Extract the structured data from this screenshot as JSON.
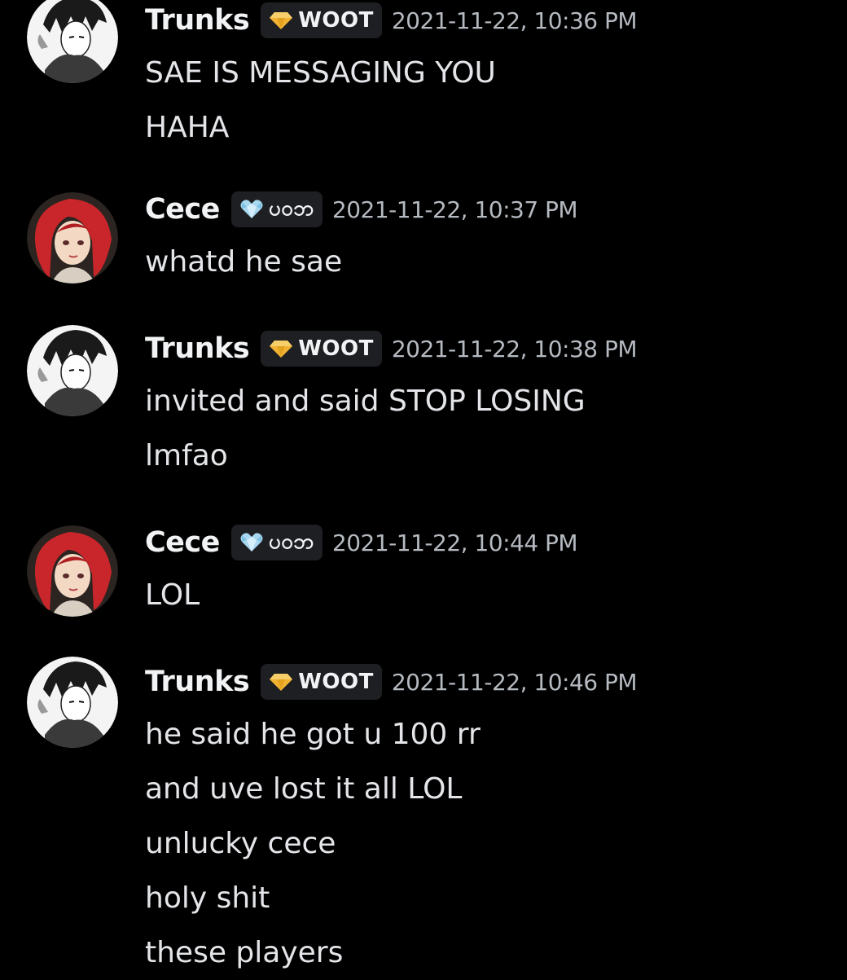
{
  "messages": [
    {
      "author": "Trunks",
      "avatar": "trunks-avatar",
      "tag_icon": "yellow-gem-icon",
      "tag": "WOOT",
      "timestamp": "2021-11-22, 10:36 PM",
      "lines": [
        "SAE IS MESSAGING YOU",
        "HAHA"
      ]
    },
    {
      "author": "Cece",
      "avatar": "cece-avatar",
      "tag_icon": "blue-heart-gem-icon",
      "tag": "ပ၀ဘ",
      "timestamp": "2021-11-22, 10:37 PM",
      "lines": [
        "whatd he sae"
      ]
    },
    {
      "author": "Trunks",
      "avatar": "trunks-avatar",
      "tag_icon": "yellow-gem-icon",
      "tag": "WOOT",
      "timestamp": "2021-11-22, 10:38 PM",
      "lines": [
        "invited and said STOP LOSING",
        "lmfao"
      ]
    },
    {
      "author": "Cece",
      "avatar": "cece-avatar",
      "tag_icon": "blue-heart-gem-icon",
      "tag": "ပ၀ဘ",
      "timestamp": "2021-11-22, 10:44 PM",
      "lines": [
        "LOL"
      ]
    },
    {
      "author": "Trunks",
      "avatar": "trunks-avatar",
      "tag_icon": "yellow-gem-icon",
      "tag": "WOOT",
      "timestamp": "2021-11-22, 10:46 PM",
      "lines": [
        "he said he got u 100 rr",
        "and uve lost it all LOL",
        "unlucky cece",
        "holy shit",
        "these players"
      ]
    }
  ],
  "colors": {
    "background": "#000000",
    "username": "#f2f3f5",
    "timestamp": "#b5bac1",
    "message_text": "#e3e5e8",
    "tag_background": "#1e1f22",
    "gem_yellow": "#f0b232",
    "gem_blue": "#a8d8f0"
  }
}
